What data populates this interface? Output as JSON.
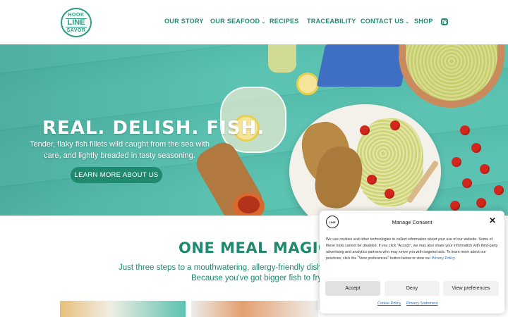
{
  "brand": {
    "logo_top": "HOOK",
    "logo_middle": "LINE",
    "logo_bottom": "SAVOR"
  },
  "nav": {
    "items": [
      {
        "label": "OUR STORY",
        "dropdown": false
      },
      {
        "label": "OUR SEAFOOD",
        "dropdown": true
      },
      {
        "label": "RECIPES",
        "dropdown": false
      },
      {
        "label": "TRACEABILITY",
        "dropdown": false
      },
      {
        "label": "CONTACT US",
        "dropdown": true
      },
      {
        "label": "SHOP",
        "dropdown": false
      }
    ],
    "dropdown_glyph": "⌄",
    "social_icon": "instagram-icon"
  },
  "hero": {
    "title": "REAL. DELISH. FISH.",
    "subtitle": "Tender, flaky fish fillets wild caught from the sea with care, and lightly breaded in tasty seasoning.",
    "cta_label": "LEARN MORE ABOUT US"
  },
  "section": {
    "title": "ONE MEAL MAGIC",
    "line1": "Just three steps to a mouthwatering, allergy-friendly dish o",
    "line2": "Because you've got bigger fish to fry."
  },
  "consent": {
    "title": "Manage Consent",
    "close_glyph": "✕",
    "body": "We use cookies and other technologies to collect information about your use of our website. Some of these tools cannot be disabled. If you click \"Accept\", we may also share your information with third-party advertising and analytics partners who may serve you with targeted ads. To learn more about our practices, click the \"View preferences\" button below or view our",
    "body_link": "Privacy Policy",
    "body_end": ".",
    "accept_label": "Accept",
    "deny_label": "Deny",
    "preferences_label": "View preferences",
    "cookie_policy_label": "Cookie Policy",
    "privacy_statement_label": "Privacy Statement"
  },
  "colors": {
    "brand_green": "#1f8a6f",
    "hero_teal": "#5cc2b1",
    "link_blue": "#1f6fbf"
  }
}
